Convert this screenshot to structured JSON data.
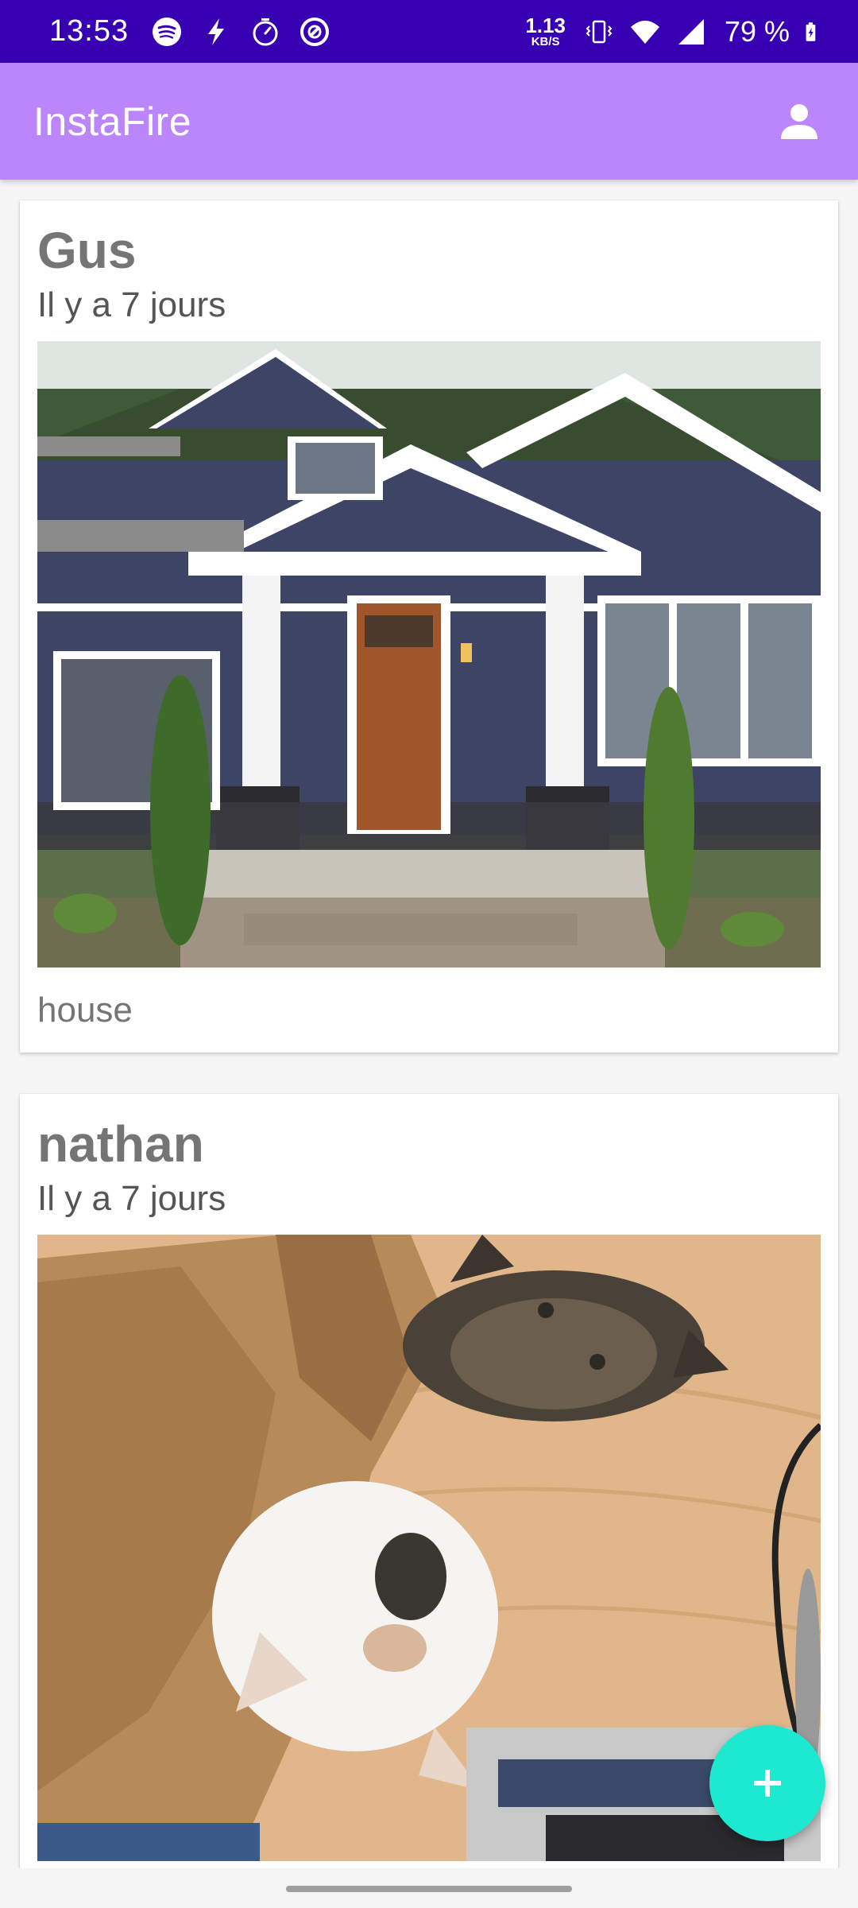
{
  "status_bar": {
    "time": "13:53",
    "net_speed_value": "1.13",
    "net_speed_unit": "KB/S",
    "battery": "79 %"
  },
  "app_bar": {
    "title": "InstaFire",
    "profile_icon": "person-icon"
  },
  "posts": [
    {
      "username": "Gus",
      "time": "Il y a 7 jours",
      "caption": "house",
      "image": "house-photo"
    },
    {
      "username": "nathan",
      "time": "Il y a 7 jours",
      "caption": "",
      "image": "cats-photo"
    }
  ],
  "fab": {
    "icon": "plus-icon"
  },
  "colors": {
    "status_bar": "#3700b3",
    "app_bar": "#bb86fc",
    "fab": "#1de9d0"
  }
}
